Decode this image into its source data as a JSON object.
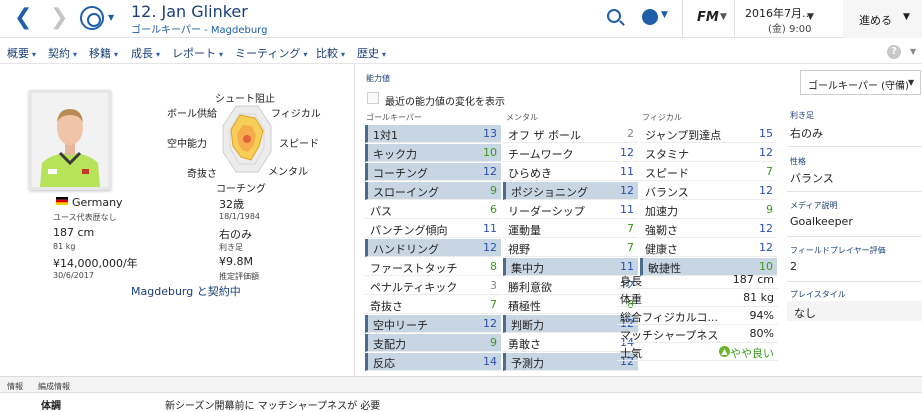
{
  "header": {
    "player_name": "12. Jan Glinker",
    "player_subtitle": "ゴールキーパー - Magdeburg",
    "game_logo": "FM",
    "date_line1": "2016年7月...",
    "date_line2": "(金) 9:00",
    "continue_label": "進める"
  },
  "menu": {
    "items": [
      {
        "label": "概要"
      },
      {
        "label": "契約"
      },
      {
        "label": "移籍"
      },
      {
        "label": "成長"
      },
      {
        "label": "レポート"
      },
      {
        "label": "ミーティング"
      },
      {
        "label": "比較"
      },
      {
        "label": "歴史"
      }
    ],
    "help_label": "?"
  },
  "profile": {
    "nationality": "Germany",
    "intl_caps": "ユース代表歴なし",
    "age": "32歳",
    "birth_date": "18/1/1984",
    "height": "187 cm",
    "weight": "81 kg",
    "preferred_foot": "右のみ",
    "preferred_foot_label": "利き足",
    "wage": "¥14,000,000/年",
    "contract_end": "30/6/2017",
    "value": "¥9.8M",
    "value_label": "推定評価額",
    "contract_link": "Magdeburg と契約中"
  },
  "radar": {
    "labels": [
      "シュート阻止",
      "フィジカル",
      "スピード",
      "メンタル",
      "コーチング",
      "奇抜さ",
      "空中能力",
      "ボール供給"
    ]
  },
  "attributes": {
    "title": "能力値",
    "show_changes_label": "最近の能力値の変化を表示",
    "gk_header": "ゴールキーパー",
    "mental_header": "メンタル",
    "physical_header": "フィジカル",
    "goalkeeping": [
      {
        "name": "1対1",
        "value": "13",
        "hl": true
      },
      {
        "name": "キック力",
        "value": "10",
        "hl": true
      },
      {
        "name": "コーチング",
        "value": "12",
        "hl": true
      },
      {
        "name": "スローイング",
        "value": "9",
        "hl": true
      },
      {
        "name": "パス",
        "value": "6",
        "hl": false
      },
      {
        "name": "パンチング傾向",
        "value": "11",
        "hl": false
      },
      {
        "name": "ハンドリング",
        "value": "12",
        "hl": true
      },
      {
        "name": "ファーストタッチ",
        "value": "8",
        "hl": false
      },
      {
        "name": "ペナルティキック",
        "value": "3",
        "hl": false
      },
      {
        "name": "奇抜さ",
        "value": "7",
        "hl": false
      },
      {
        "name": "空中リーチ",
        "value": "12",
        "hl": true
      },
      {
        "name": "支配力",
        "value": "9",
        "hl": true
      },
      {
        "name": "反応",
        "value": "14",
        "hl": true
      },
      {
        "name": "飛び出し",
        "value": "11",
        "hl": false
      }
    ],
    "mental": [
      {
        "name": "オフ ザ ボール",
        "value": "2",
        "hl": false
      },
      {
        "name": "チームワーク",
        "value": "12",
        "hl": false
      },
      {
        "name": "ひらめき",
        "value": "11",
        "hl": false
      },
      {
        "name": "ポジショニング",
        "value": "12",
        "hl": true
      },
      {
        "name": "リーダーシップ",
        "value": "11",
        "hl": false
      },
      {
        "name": "運動量",
        "value": "7",
        "hl": false
      },
      {
        "name": "視野",
        "value": "7",
        "hl": false
      },
      {
        "name": "集中力",
        "value": "11",
        "hl": true
      },
      {
        "name": "勝利意欲",
        "value": "12",
        "hl": false
      },
      {
        "name": "積極性",
        "value": "8",
        "hl": false
      },
      {
        "name": "判断力",
        "value": "12",
        "hl": true
      },
      {
        "name": "勇敢さ",
        "value": "14",
        "hl": false
      },
      {
        "name": "予測力",
        "value": "12",
        "hl": true
      },
      {
        "name": "冷静さ",
        "value": "11",
        "hl": false
      }
    ],
    "physical": [
      {
        "name": "ジャンプ到達点",
        "value": "15",
        "hl": false
      },
      {
        "name": "スタミナ",
        "value": "12",
        "hl": false
      },
      {
        "name": "スピード",
        "value": "7",
        "hl": false
      },
      {
        "name": "バランス",
        "value": "12",
        "hl": false
      },
      {
        "name": "加速力",
        "value": "9",
        "hl": false
      },
      {
        "name": "強靭さ",
        "value": "12",
        "hl": false
      },
      {
        "name": "健康さ",
        "value": "12",
        "hl": false
      },
      {
        "name": "敏捷性",
        "value": "10",
        "hl": true
      }
    ]
  },
  "stats": [
    {
      "name": "身長",
      "value": "187 cm"
    },
    {
      "name": "体重",
      "value": "81 kg"
    },
    {
      "name": "総合フィジカルコ...",
      "value": "94%"
    },
    {
      "name": "マッチシャープネス",
      "value": "80%"
    },
    {
      "name": "士気",
      "value": "やや良い"
    }
  ],
  "right_panel": {
    "position_dropdown": "ゴールキーパー (守備)",
    "preferred_foot_head": "利き足",
    "preferred_foot": "右のみ",
    "personality_head": "性格",
    "personality": "バランス",
    "media_head": "メディア説明",
    "media": "Goalkeeper",
    "outfield_head": "フィールドプレイヤー評価",
    "outfield": "2",
    "playstyle_head": "プレイスタイル",
    "playstyle": "なし"
  },
  "bottom": {
    "tab_info": "情報",
    "tab_team": "編成情報",
    "condition_label": "体調",
    "condition_text": "新シーズン開幕前に マッチシャープネスが 必要"
  },
  "colors": {
    "accent": "#1b3f77",
    "highlight_row": "#c8d5e3",
    "value_blue": "#2a4fb0",
    "value_green": "#3a9a1a",
    "value_grey": "#888888"
  }
}
